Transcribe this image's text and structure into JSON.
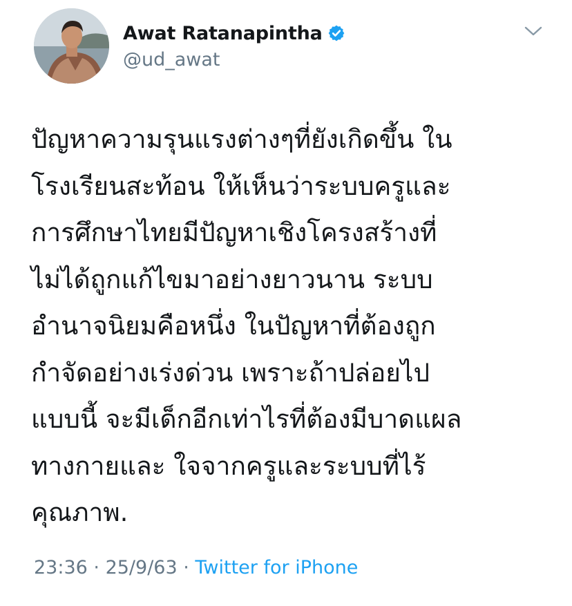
{
  "author": {
    "display_name": "Awat Ratanapintha",
    "handle": "@ud_awat",
    "verified": true,
    "verified_color": "#1da1f2"
  },
  "tweet": {
    "lines": [
      "ปัญหาความรุนแรงต่างๆที่ยังเกิดขึ้น ใน",
      "โรงเรียนสะท้อน ให้เห็นว่าระบบครูและ",
      "การศึกษาไทยมีปัญหาเชิงโครงสร้างที่",
      "ไม่ได้ถูกแก้ไขมาอย่างยาวนาน ระบบ",
      "อำนาจนิยมคือหนึ่ง ในปัญหาที่ต้องถูก",
      "กำจัดอย่างเร่งด่วน เพราะถ้าปล่อยไป",
      "แบบนี้ จะมีเด็กอีกเท่าไรที่ต้องมีบาดแผล",
      "ทางกายและ ใจจากครูและระบบที่ไร้",
      "คุณภาพ."
    ]
  },
  "meta": {
    "time": "23:36",
    "separator1": " · ",
    "date": "25/9/63",
    "separator2": " · ",
    "source": "Twitter for iPhone"
  },
  "icons": {
    "verified": "verified-badge-icon",
    "menu": "chevron-down-icon"
  },
  "colors": {
    "text": "#14171a",
    "secondary": "#657786",
    "link": "#1da1f2"
  }
}
